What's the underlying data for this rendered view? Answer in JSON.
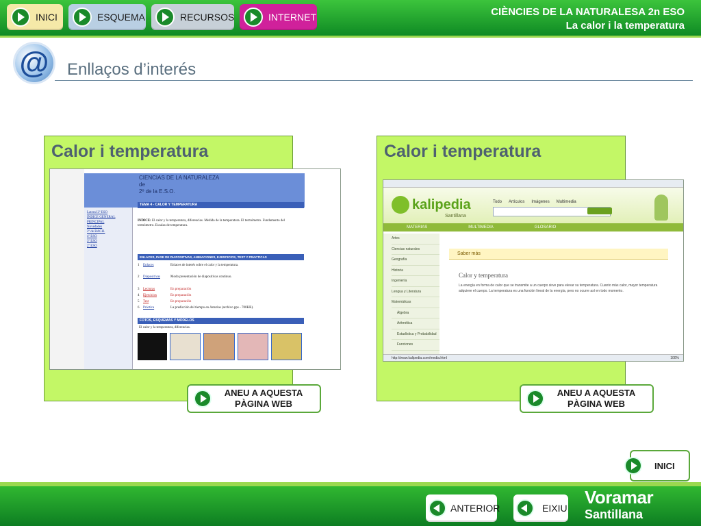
{
  "header": {
    "nav": [
      {
        "label": "INICI",
        "color": "#f5e9a8"
      },
      {
        "label": "ESQUEMA",
        "color": "#b9cfe3"
      },
      {
        "label": "RECURSOS",
        "color": "#c7d0d8"
      },
      {
        "label": "INTERNET",
        "color": "#d0219b"
      }
    ],
    "subject": "CIÈNCIES DE LA NATURALESA 2n ESO",
    "topic": "La calor i la temperatura"
  },
  "page_title": "Enllaços d’interés",
  "panels": [
    {
      "title": "Calor i temperatura",
      "link_line1": "ANEU A AQUESTA",
      "link_line2": "PÀGINA WEB",
      "screenshot": {
        "heading": [
          "CIENCIAS DE LA NATURALEZA",
          "de",
          "2º de la E.S.O."
        ],
        "tema": "TEMA 4 - CALOR Y TEMPERATURA",
        "indice_label": "INDICE:",
        "indice_text": "El calor y la temperatura, diferencias. Medida de la temperatura. El termómetro. Fundamento del termómetro. Escalas de temperatura.",
        "side_links": [
          "Lateral 2º ESO",
          "INDICE GENERAL",
          "PRINCIPAL",
          "Novedades",
          "2º de BACH.",
          "4º ESO",
          "3º ESO",
          "2º ESO"
        ],
        "section": "ENLACES, PASE DE DIAPOSITIVAS, ANIMACIONES, EJERCICIOS, TEST Y PRACTICAS",
        "rows": [
          {
            "num": "1",
            "link": "Enlaces",
            "text": "Enlaces de interés sobre el calor y la temperatura."
          },
          {
            "num": "2",
            "link": "Diapositivas",
            "text": "Modo presentación de diapositivas continuo."
          },
          {
            "num": "3",
            "link": "Lecturas",
            "text": "En preparación"
          },
          {
            "num": "4",
            "link": "Ejercicios",
            "text": "En preparación"
          },
          {
            "num": "5",
            "link": "Test",
            "text": "En preparación"
          },
          {
            "num": "6",
            "link": "Práctica",
            "text": "La predicción del tiempo en Asturias (archivo pps - 700KB)."
          }
        ],
        "fotos": "FOTOS, ESQUEMAS Y MODELOS",
        "fotos_sub": "El calor y la temperatura, diferencias."
      }
    },
    {
      "title": "Calor i temperatura",
      "link_line1": "ANEU A AQUESTA",
      "link_line2": "PÀGINA WEB",
      "screenshot": {
        "brand": "kalipedia",
        "brand_sub": "Santillana",
        "tabs": [
          "Todo",
          "Artículos",
          "Imágenes",
          "Multimedia"
        ],
        "menu": [
          "MATERIAS",
          "MULTIMEDIA",
          "GLOSARIO"
        ],
        "side_items": [
          "Artes",
          "Ciencias naturales",
          "Geografía",
          "Historia",
          "Ingeniería",
          "Lengua y Literatura",
          "Matemáticas",
          "Álgebra",
          "Aritmética",
          "Estadística y Probabilidad",
          "Funciones"
        ],
        "saber": "Saber más",
        "article_title": "Calor y temperatura",
        "article_text": "La energía en forma de calor que se transmite a un cuerpo sirve para elevar su temperatura. Cuanto más calor, mayor temperatura adquiere el cuerpo. La temperatura es una función lineal de la energía, pero no ocurre así en todo momento.",
        "status_url": "http://www.kalipedia.com/media.html",
        "zoom": "100%"
      }
    }
  ],
  "home_label": "INICI",
  "footer": {
    "prev_label": "ANTERIOR",
    "exit_label": "EIXIU",
    "brand_line1": "Voramar",
    "brand_line2": "Santillana"
  }
}
